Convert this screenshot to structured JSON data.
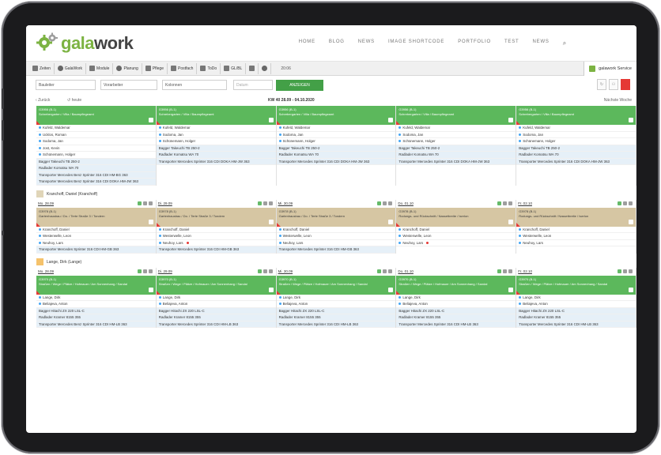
{
  "brand": {
    "part1": "gala",
    "part2": "work"
  },
  "topnav": [
    "HOME",
    "BLOG",
    "NEWS",
    "IMAGE SHORTCODE",
    "PORTFOLIO",
    "TEST",
    "NEWS"
  ],
  "toolbar": {
    "items": [
      "Zeiten",
      "GalaWork",
      "Module",
      "Planung",
      "Pflege",
      "Postfach",
      "ToDo",
      "GL/BL"
    ],
    "time": "20:06",
    "user": "galawork Service"
  },
  "filters": {
    "f1": "Bauleiter",
    "f2": "Vorarbeiter",
    "f3": "Kolonnen",
    "f4": "Datum",
    "button": "ANZEIGEN"
  },
  "weekbar": {
    "back": "Zurück",
    "today": "heute",
    "week": "KW 40     28.09 - 04.10.2020",
    "next": "Nächste Woche"
  },
  "section1": {
    "cols": [
      {
        "head1": "G3956  (B-1)",
        "head2": "Schrebergarten / Villa / Baumpflegeamt",
        "rows": [
          "Kufeld, Waldemar",
          "Ucklos, Roman",
          "Sodoma, Jan",
          "Jost, Kevin",
          "Schünemann, Holger"
        ],
        "machines": [
          "Bagger Takeuchi TB 250-2",
          "Radlader Komatsu WA 70",
          "Transporter Mercedes Benz Sprinter 316 CDI HM-BG 363",
          "Transporter Mercedes Benz Sprinter 316 CDI DOKA HM-JW 363"
        ]
      },
      {
        "head1": "G3956  (B-1)",
        "head2": "Schrebergarten / Villa / Baumpflegeamt",
        "rows": [
          "Kufeld, Waldemar",
          "Sodoma, Jan",
          "Schünemann, Holger"
        ],
        "machines": [
          "Bagger Takeuchi TB 250-2",
          "Radlader Komatsu WA 70",
          "Transporter Mercedes Sprinter 316 CDI DOKA HM-JW 363"
        ]
      },
      {
        "head1": "G3956  (B-1)",
        "head2": "Schrebergarten / Villa / Baumpflegeamt",
        "rows": [
          "Kufeld, Waldemar",
          "Sodoma, Jan",
          "Schünemann, Holger"
        ],
        "machines": [
          "Bagger Takeuchi TB 250-2",
          "Radlader Komatsu WA 70",
          "Transporter Mercedes Sprinter 316 CDI DOKA HM-JW 363"
        ]
      },
      {
        "head1": "G3956  (B-1)",
        "head2": "Schrebergarten / Villa / Baumpflegeamt",
        "rows": [
          "Kufeld, Waldemar",
          "Sodoma, Jan",
          "Schünemann, Holger"
        ],
        "machines": [
          "Bagger Takeuchi TB 250-2",
          "Radlader Komatsu WA 70",
          "Transporter Mercedes Sprinter 316 CDI DOKA HM-JW 363"
        ]
      },
      {
        "head1": "G3956  (B-1)",
        "head2": "Schrebergarten / Villa / Baumpflegeamt",
        "rows": [
          "Kufeld, Waldemar",
          "Sodoma, Jan",
          "Schünemann, Holger"
        ],
        "machines": [
          "Bagger Takeuchi TB 250-2",
          "Radlader Komatsu WA 70",
          "Transporter Mercedes Sprinter 316 CDI DOKA HM-JW 363"
        ]
      }
    ]
  },
  "person1": "Kranchoff, Daniel (Kranchoff)",
  "section2": {
    "days": [
      "Mo. 28.09",
      "Di. 29.09",
      "Mi. 30.09",
      "Do. 01.10",
      "Fr. 02.10"
    ],
    "cols": [
      {
        "head1": "G3978  (B-1)",
        "head2": "Gartenhausbau / Do. / Terte Straße 3 / Tondern",
        "rows": [
          "Kranchoff, Daniel",
          "Westerwelle, Leon",
          "Neuhoy, Lars"
        ],
        "machines": [
          "Transporter Mercedes Sprinter 316 CDI HM-GB 363"
        ]
      },
      {
        "head1": "G3978  (B-1)",
        "head2": "Gartenhausbau / Do. / Terte Straße 3 / Tondern",
        "rows": [
          "Kranchoff, Daniel",
          "Westerwelle, Leon",
          "Neuhoy, Lars"
        ],
        "machines": [
          "Transporter Mercedes Sprinter 316 CDI HM-GB 363"
        ]
      },
      {
        "head1": "G3978  (B-1)",
        "head2": "Gartenhausbau / Do. / Terte Straße 3 / Tondern",
        "rows": [
          "Kranchoff, Daniel",
          "Westerwelle, Leon",
          "Neuhoy, Lars"
        ],
        "machines": [
          "Transporter Mercedes Sprinter 316 CDI HM-GB 363"
        ]
      },
      {
        "head1": "G3978  (B-1)",
        "head2": "Rodungs- und Rückschnitt / Nassetbreite / Iserlon",
        "rows": [
          "Kranchoff, Daniel",
          "Westerwelle, Leon",
          "Neuhoy, Lars"
        ],
        "machines": []
      },
      {
        "head1": "G3978  (B-1)",
        "head2": "Rodungs- und Rückschnitt / Nassetbreite / Iserlon",
        "rows": [
          "Kranchoff, Daniel",
          "Westerwelle, Leon",
          "Neuhoy, Lars"
        ],
        "machines": []
      }
    ]
  },
  "person2": "Lange, Dirk (Lange)",
  "section3": {
    "days": [
      "Mo. 28.09",
      "Di. 29.09",
      "Mi. 30.09",
      "Do. 01.10",
      "Fr. 02.10"
    ],
    "cols": [
      {
        "head1": "G3970  (B-1)",
        "head2": "Straßen / Wege / Plätze / Hofmauer / Am Sonnenhang / Sandal",
        "rows": [
          "Lange, Dirk",
          "Beliajeva, Anton"
        ],
        "machines": [
          "Bagger Hitachi ZX 220 LSL-C",
          "Radlader Kramer 8155 355",
          "Transporter Mercedes Benz Sprinter 316 CDI HM-LB 363"
        ]
      },
      {
        "head1": "G3970  (B-1)",
        "head2": "Straßen / Wege / Plätze / Hofmauer / Am Sonnenhang / Sandal",
        "rows": [
          "Lange, Dirk",
          "Beliajeva, Anton"
        ],
        "machines": [
          "Bagger Hitachi ZX 220 LSL-C",
          "Radlader Kramer 8155 355",
          "Transporter Mercedes Sprinter 316 CDI HM-LB 363"
        ]
      },
      {
        "head1": "G3970  (B-1)",
        "head2": "Straßen / Wege / Plätze / Hofmauer / Am Sonnenhang / Sandal",
        "rows": [
          "Lange, Dirk",
          "Beliajeva, Anton"
        ],
        "machines": [
          "Bagger Hitachi ZX 220 LSL-C",
          "Radlader Kramer 8155 355",
          "Transporter Mercedes Sprinter 316 CDI HM-LB 363"
        ]
      },
      {
        "head1": "G3970  (B-1)",
        "head2": "Straßen / Wege / Plätze / Hofmauer / Am Sonnenhang / Sandal",
        "rows": [
          "Lange, Dirk",
          "Beliajeva, Anton"
        ],
        "machines": [
          "Bagger Hitachi ZX 220 LSL-C",
          "Radlader Kramer 8155 355",
          "Transporter Mercedes Sprinter 316 CDI HM-LB 363"
        ]
      },
      {
        "head1": "G3970  (B-1)",
        "head2": "Straßen / Wege / Plätze / Hofmauer / Am Sonnenhang / Sandal",
        "rows": [
          "Lange, Dirk",
          "Beliajeva, Anton"
        ],
        "machines": [
          "Bagger Hitachi ZX 220 LSL-C",
          "Radlader Kramer 8155 355",
          "Transporter Mercedes Sprinter 316 CDI HM-LB 363"
        ]
      }
    ]
  },
  "colors": {
    "green": "#5cb85c",
    "tan": "#d6c6a3",
    "accent": "#7cb342"
  }
}
